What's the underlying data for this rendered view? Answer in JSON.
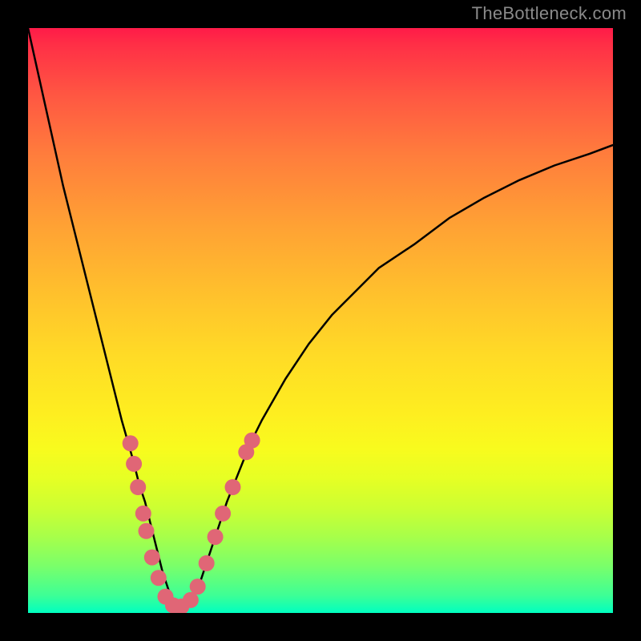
{
  "watermark": "TheBottleneck.com",
  "chart_data": {
    "type": "line",
    "title": "",
    "xlabel": "",
    "ylabel": "",
    "xlim": [
      0,
      100
    ],
    "ylim": [
      0,
      100
    ],
    "series": [
      {
        "name": "curve",
        "x": [
          0,
          2,
          4,
          6,
          8,
          10,
          12,
          14,
          16,
          18,
          19,
          20,
          21,
          22,
          23,
          24,
          25,
          26,
          27,
          28,
          29,
          30,
          32,
          34,
          36,
          38,
          40,
          44,
          48,
          52,
          56,
          60,
          66,
          72,
          78,
          84,
          90,
          96,
          100
        ],
        "y": [
          100,
          91,
          82,
          73,
          65,
          57,
          49,
          41,
          33,
          26,
          22,
          19,
          15,
          11,
          7,
          4,
          2,
          1,
          1,
          2,
          4,
          7,
          13,
          19,
          24,
          29,
          33,
          40,
          46,
          51,
          55,
          59,
          63,
          67.5,
          71,
          74,
          76.5,
          78.5,
          80
        ]
      }
    ],
    "markers": {
      "name": "highlight-dots",
      "color": "#e06676",
      "radius": 10,
      "points": [
        {
          "x": 17.5,
          "y": 29
        },
        {
          "x": 18.1,
          "y": 25.5
        },
        {
          "x": 18.8,
          "y": 21.5
        },
        {
          "x": 19.7,
          "y": 17
        },
        {
          "x": 20.2,
          "y": 14
        },
        {
          "x": 21.2,
          "y": 9.5
        },
        {
          "x": 22.3,
          "y": 6
        },
        {
          "x": 23.5,
          "y": 2.8
        },
        {
          "x": 24.8,
          "y": 1.3
        },
        {
          "x": 26.2,
          "y": 1.1
        },
        {
          "x": 27.8,
          "y": 2.2
        },
        {
          "x": 29.0,
          "y": 4.5
        },
        {
          "x": 30.5,
          "y": 8.5
        },
        {
          "x": 32.0,
          "y": 13
        },
        {
          "x": 33.3,
          "y": 17
        },
        {
          "x": 35.0,
          "y": 21.5
        },
        {
          "x": 37.3,
          "y": 27.5
        },
        {
          "x": 38.3,
          "y": 29.5
        }
      ]
    },
    "gradient_stops": [
      {
        "pos": 0,
        "color": "#ff1b48"
      },
      {
        "pos": 50,
        "color": "#ffd827"
      },
      {
        "pos": 100,
        "color": "#00ffc0"
      }
    ]
  }
}
